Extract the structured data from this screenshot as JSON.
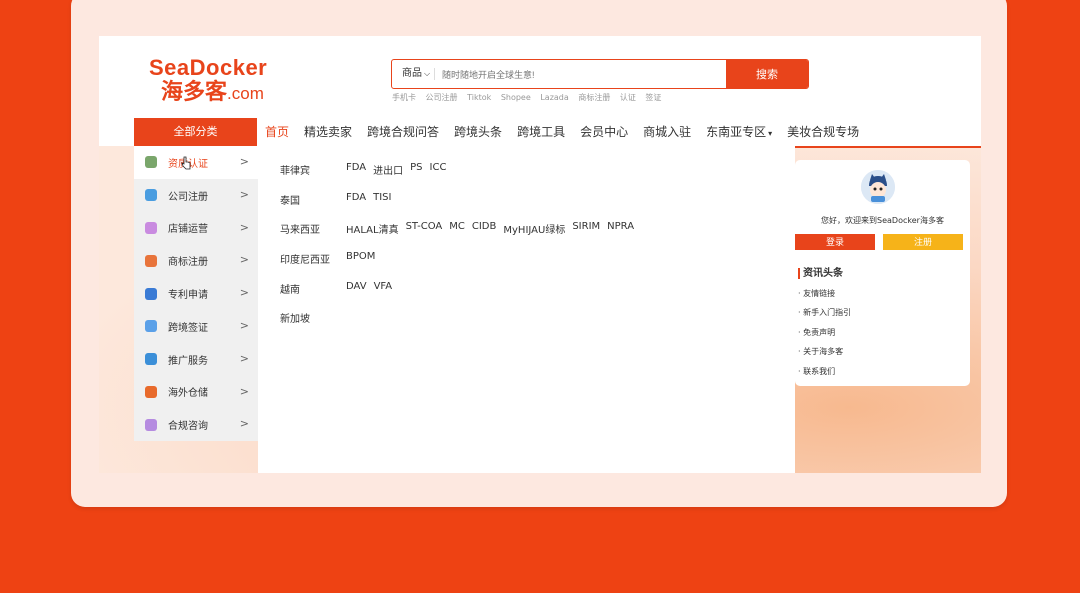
{
  "logo": {
    "en": "SeaDocker",
    "zh": "海多客",
    "domain": ".com"
  },
  "search": {
    "type": "商品",
    "placeholder": "随时随地开启全球生意!",
    "button": "搜索"
  },
  "hot_keywords": [
    "手机卡",
    "公司注册",
    "Tiktok",
    "Shopee",
    "Lazada",
    "商标注册",
    "认证",
    "签证"
  ],
  "all_categories": "全部分类",
  "nav": [
    {
      "label": "首页",
      "active": true
    },
    {
      "label": "精选卖家"
    },
    {
      "label": "跨境合规问答"
    },
    {
      "label": "跨境头条"
    },
    {
      "label": "跨境工具"
    },
    {
      "label": "会员中心"
    },
    {
      "label": "商城入驻"
    },
    {
      "label": "东南亚专区",
      "caret": "▾"
    },
    {
      "label": "美妆合规专场"
    }
  ],
  "sidebar": [
    {
      "label": "资质认证",
      "icon": "certificate-icon",
      "color": "#7aa66b",
      "active": true
    },
    {
      "label": "公司注册",
      "icon": "building-icon",
      "color": "#4a9de0"
    },
    {
      "label": "店铺运营",
      "icon": "shop-icon",
      "color": "#c98be0"
    },
    {
      "label": "商标注册",
      "icon": "award-icon",
      "color": "#e8743b"
    },
    {
      "label": "专利申请",
      "icon": "document-icon",
      "color": "#3a7bd5"
    },
    {
      "label": "跨境签证",
      "icon": "passport-icon",
      "color": "#5aa0e8"
    },
    {
      "label": "推广服务",
      "icon": "shield-icon",
      "color": "#3b8fd8"
    },
    {
      "label": "海外仓储",
      "icon": "warehouse-icon",
      "color": "#e86a2b"
    },
    {
      "label": "合规咨询",
      "icon": "chat-icon",
      "color": "#b58be0"
    }
  ],
  "arrow": ">",
  "panel": [
    {
      "country": "菲律宾",
      "items": [
        "FDA",
        "进出口",
        "PS",
        "ICC"
      ]
    },
    {
      "country": "泰国",
      "items": [
        "FDA",
        "TISI"
      ]
    },
    {
      "country": "马来西亚",
      "items": [
        "HALAL清真",
        "ST-COA",
        "MC",
        "CIDB",
        "MyHIJAU绿标",
        "SIRIM",
        "NPRA"
      ]
    },
    {
      "country": "印度尼西亚",
      "items": [
        "BPOM"
      ]
    },
    {
      "country": "越南",
      "items": [
        "DAV",
        "VFA"
      ]
    },
    {
      "country": "新加坡",
      "items": []
    }
  ],
  "right": {
    "welcome": "您好，欢迎来到SeaDocker海多客",
    "login": "登录",
    "register": "注册",
    "news_title": "资讯头条",
    "news": [
      "· 友情链接",
      "· 新手入门指引",
      "· 免责声明",
      "· 关于海多客",
      "· 联系我们"
    ]
  }
}
